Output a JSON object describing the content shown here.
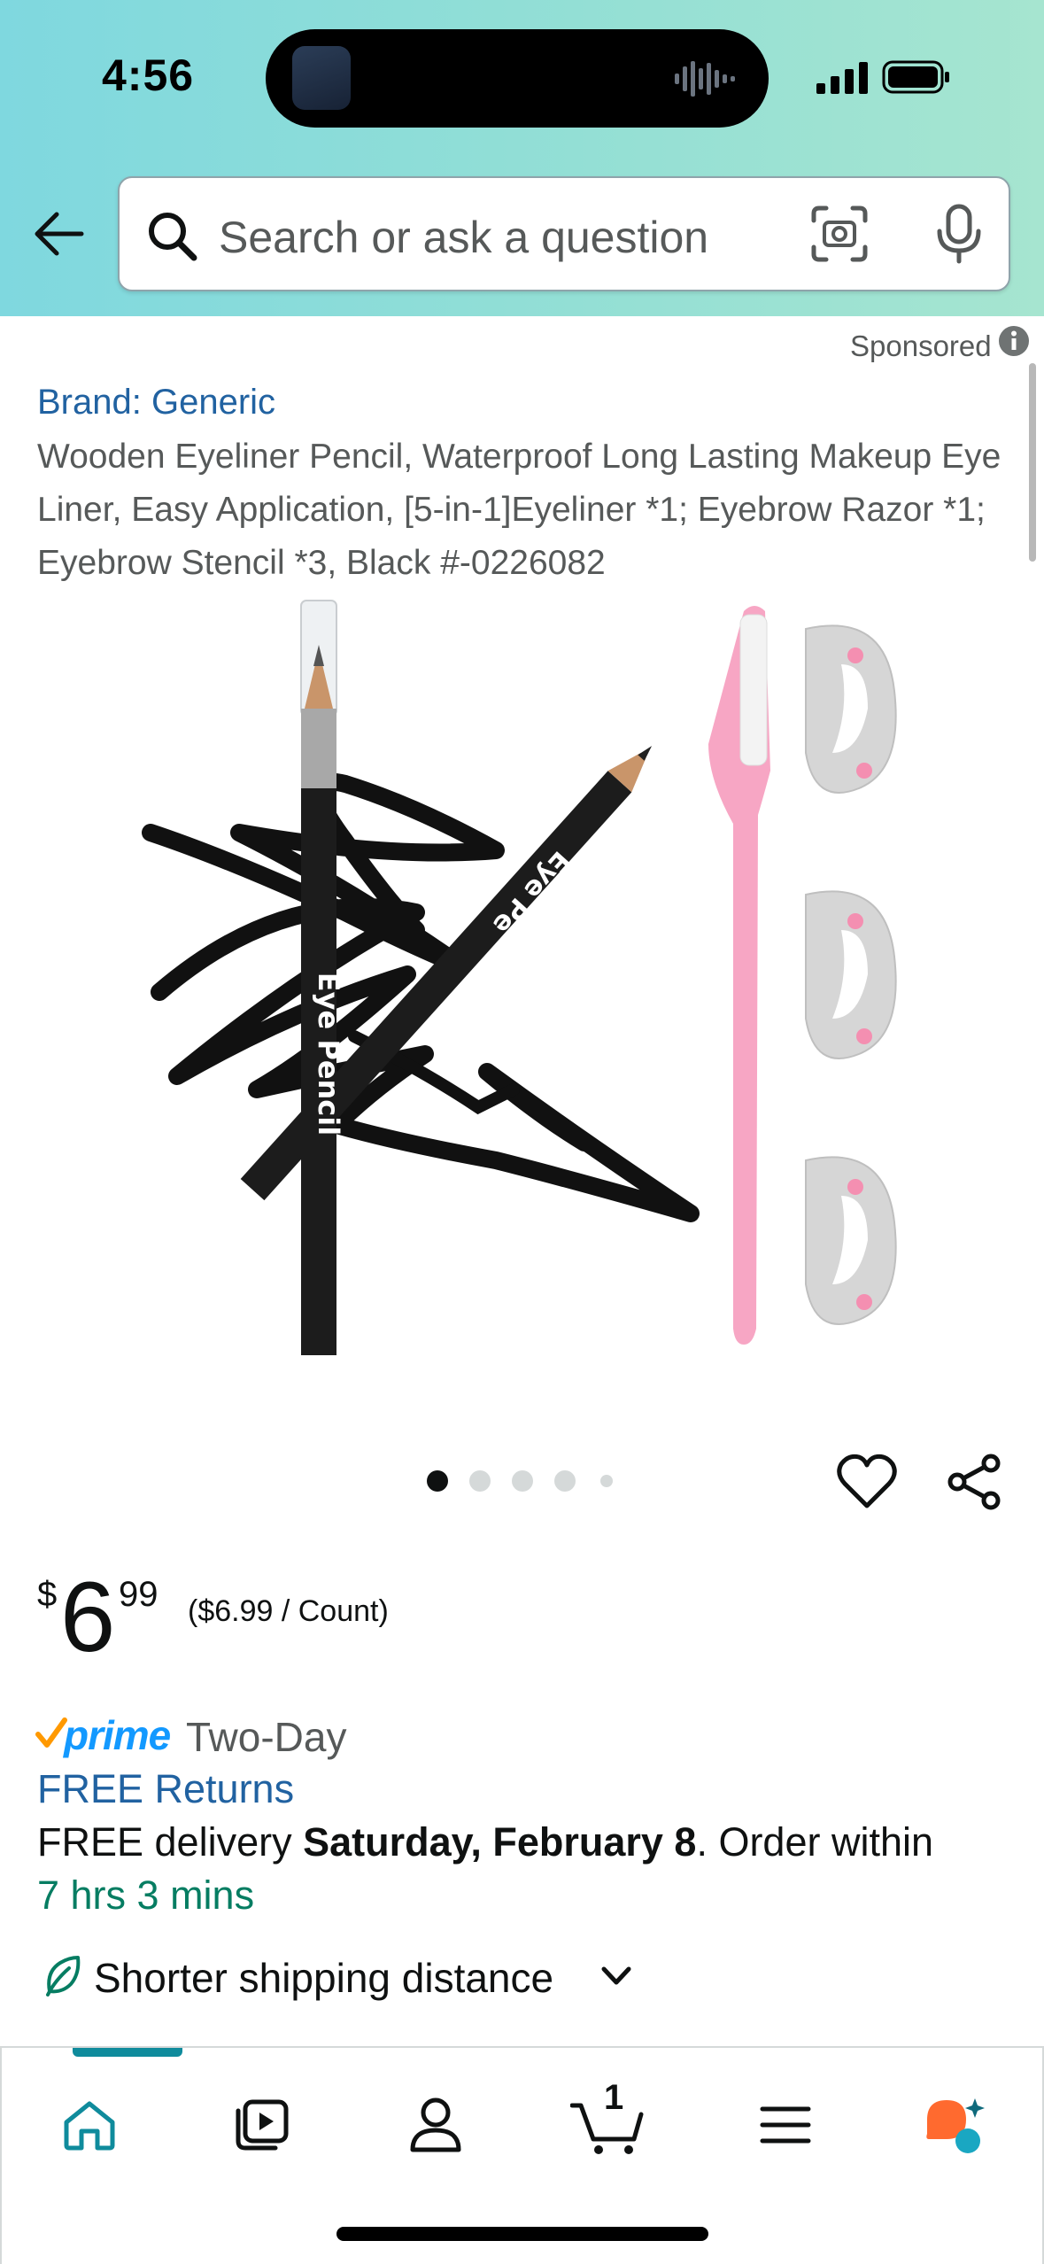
{
  "status_bar": {
    "time": "4:56"
  },
  "search": {
    "placeholder": "Search or ask a question"
  },
  "sponsored_label": "Sponsored",
  "product": {
    "brand": "Brand: Generic",
    "title": "Wooden Eyeliner Pencil, Waterproof Long Lasting Makeup Eye Liner, Easy Application, [5-in-1]Eyeliner *1; Eyebrow Razor *1; Eyebrow Stencil *3, Black #-0226082",
    "image_pencil_text_1": "Eye Pencil",
    "image_pencil_text_2": "Eye Pe",
    "image_count": 5,
    "active_image_index": 0
  },
  "price": {
    "symbol": "$",
    "whole": "6",
    "fraction": "99",
    "unit_price": "($6.99 / Count)"
  },
  "delivery": {
    "prime_word": "prime",
    "prime_speed": "Two-Day",
    "free_returns": "FREE Returns",
    "free_delivery_prefix": "FREE delivery ",
    "delivery_date": "Saturday, February 8",
    "order_within_suffix": ". Order within",
    "countdown": "7 hrs 3 mins"
  },
  "shipping": {
    "label": "Shorter shipping distance"
  },
  "bottom_nav": {
    "cart_count": "1",
    "items": [
      "home",
      "video",
      "account",
      "cart",
      "menu",
      "rufus"
    ]
  },
  "colors": {
    "header_gradient_start": "#7fd8df",
    "header_gradient_end": "#a6e5d0",
    "link_blue": "#2162a1",
    "prime_blue": "#1399ff",
    "prime_check": "#ff9900",
    "countdown_green": "#067d62",
    "nav_accent": "#0f8b9c"
  }
}
